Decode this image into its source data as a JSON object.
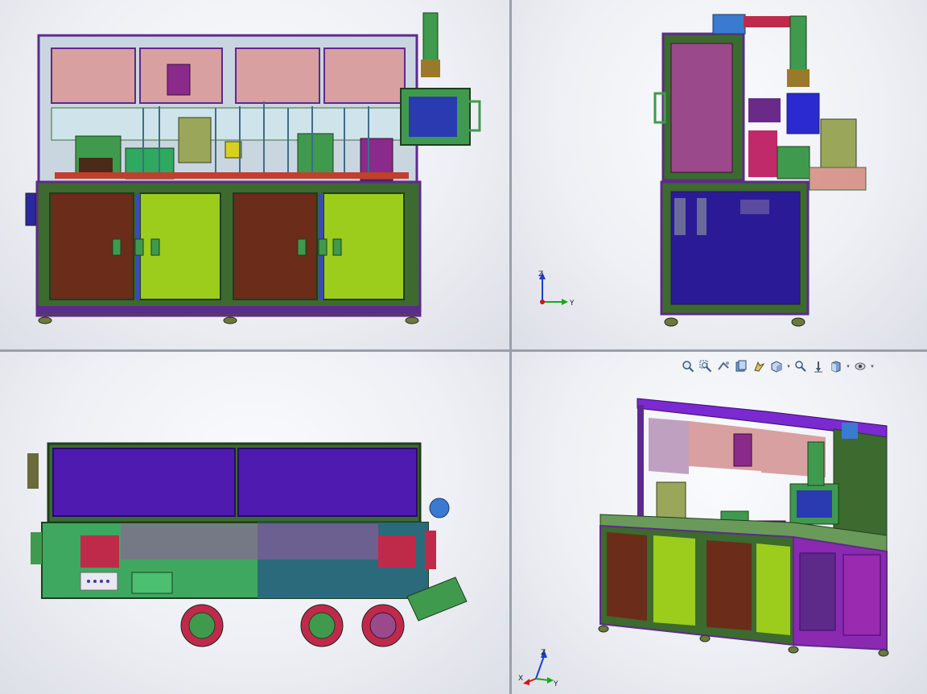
{
  "window": {
    "layout": "four-viewport"
  },
  "viewports": [
    {
      "name": "front",
      "triad": null
    },
    {
      "name": "right",
      "triad": {
        "up": "Z",
        "right": "Y"
      }
    },
    {
      "name": "top",
      "triad": null
    },
    {
      "name": "isometric",
      "triad": {
        "up": "Z",
        "right": "X",
        "out": "Y"
      }
    }
  ],
  "hud_toolbar": {
    "buttons": [
      {
        "icon": "zoom-to-fit-icon"
      },
      {
        "icon": "zoom-to-area-icon"
      },
      {
        "icon": "previous-view-icon"
      },
      {
        "icon": "section-view-icon"
      },
      {
        "icon": "dynamic-annotation-icon"
      },
      {
        "icon": "view-orientation-icon",
        "dropdown": true
      },
      {
        "icon": "display-style-icon"
      },
      {
        "icon": "hide-show-items-icon"
      },
      {
        "icon": "edit-appearance-icon",
        "dropdown": true
      },
      {
        "icon": "apply-scene-icon",
        "dropdown": true
      }
    ]
  },
  "colors": {
    "frame": "#5e2a8a",
    "green_door": "#9ccd1c",
    "brown_door": "#6b2c1a",
    "navy_panel": "#2a1a96",
    "pink_panel": "#d8a0a0",
    "violet_panel": "#4e1ab0",
    "teal_green": "#3f9a4e",
    "axis_x": "#d11414",
    "axis_y": "#1aa81a",
    "axis_z": "#1a3fd1"
  }
}
